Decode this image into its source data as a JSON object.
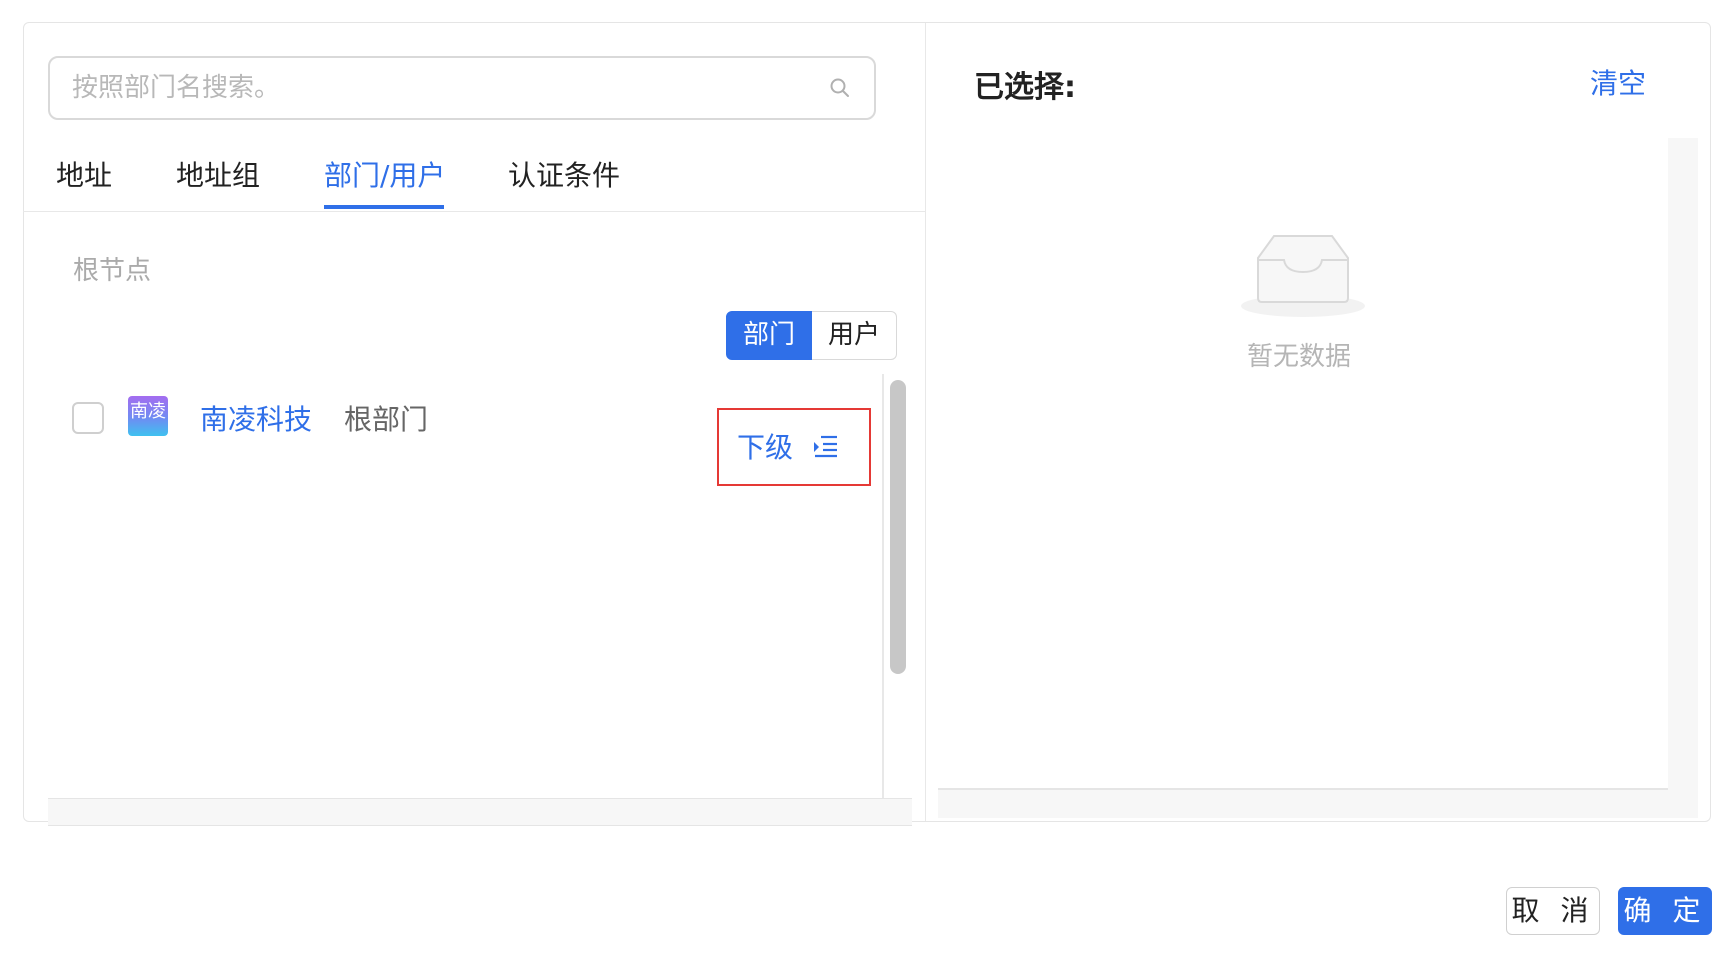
{
  "search": {
    "placeholder": "按照部门名搜索。"
  },
  "tabs": [
    {
      "label": "地址"
    },
    {
      "label": "地址组"
    },
    {
      "label": "部门/用户"
    },
    {
      "label": "认证条件"
    }
  ],
  "active_tab": "部门/用户",
  "breadcrumb": "根节点",
  "segmented": {
    "dept": "部门",
    "user": "用户",
    "selected": "部门"
  },
  "list": [
    {
      "avatar_text": "南凌",
      "name": "南凌科技",
      "tag": "根部门",
      "checked": false,
      "action_label": "下级"
    }
  ],
  "selected_panel": {
    "title": "已选择:",
    "clear_label": "清空",
    "empty_text": "暂无数据"
  },
  "footer": {
    "cancel_label": "取 消",
    "ok_label": "确 定"
  },
  "colors": {
    "accent": "#2f6fe8",
    "highlight_border": "#e53935"
  }
}
